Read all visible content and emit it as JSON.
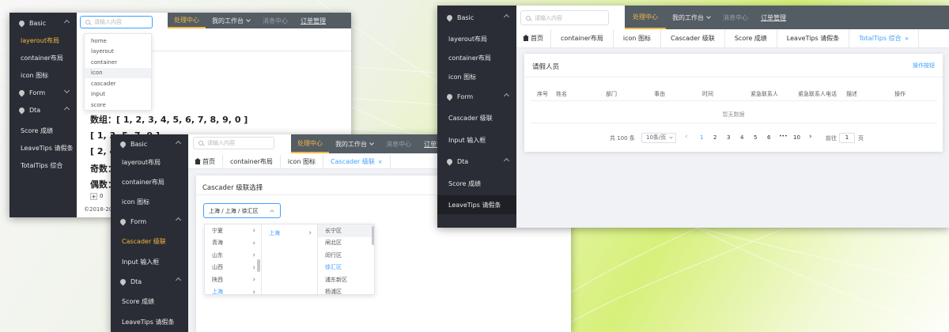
{
  "icons": {
    "group": "location-pin-icon",
    "collapse": "chevron-up-icon",
    "search": "search-icon",
    "home": "home-icon",
    "close": "close-icon",
    "expand": "chevron-right-icon"
  },
  "colors": {
    "accent": "#f2b843",
    "link": "#409eff",
    "sidebar": "#2a2d35",
    "topbar": "#545c64"
  },
  "w1": {
    "sidebar": {
      "basic": "Basic",
      "items": [
        "layerout布局",
        "container布局",
        "icon 图标"
      ],
      "form": "Form",
      "dta": "Dta",
      "dta_items": [
        "Score 成绩",
        "LeaveTips 请假条",
        "TotalTips 综合"
      ]
    },
    "search_placeholder": "请输入内容",
    "topnav": [
      "处理中心",
      "我的工作台",
      "消息中心",
      "订单管理"
    ],
    "suggestions": [
      "home",
      "layerout",
      "container",
      "icon",
      "cascader",
      "input",
      "score"
    ],
    "array_line": "数组：[ 1, 2, 3, 4, 5, 6, 7, 8, 9, 0 ]",
    "line2": "[ 1, 3, 5, 7, 9 ]",
    "line3": "[ 2, 4,",
    "odd": "奇数：",
    "even": "偶数：",
    "stepper_plus": "+",
    "stepper_value": "0",
    "copyright": "©2018-202"
  },
  "w2": {
    "sidebar": {
      "basic": "Basic",
      "items": [
        "layerout布局",
        "container布局",
        "icon 图标"
      ],
      "form": "Form",
      "form_items": [
        "Cascader 级联",
        "Input 输入框"
      ],
      "dta": "Dta",
      "dta_items": [
        "Score 成绩",
        "LeaveTips 请假条"
      ]
    },
    "search_placeholder": "请输入内容",
    "topnav": [
      "处理中心",
      "我的工作台",
      "消息中心",
      "订单管理"
    ],
    "tabs": [
      "首页",
      "container布局",
      "icon 图标",
      "Cascader 级联"
    ],
    "panel_title": "Cascader 级联选择",
    "cascader_value": "上海 / 上海 / 徐汇区",
    "col1": [
      "宁夏",
      "青海",
      "山东",
      "山西",
      "陕西",
      "上海"
    ],
    "col2": [
      "上海"
    ],
    "col3": [
      "长宁区",
      "闸北区",
      "闵行区",
      "徐汇区",
      "浦东新区",
      "杨浦区"
    ]
  },
  "w3": {
    "sidebar": {
      "basic": "Basic",
      "items": [
        "layerout布局",
        "container布局",
        "icon 图标"
      ],
      "form": "Form",
      "form_items": [
        "Cascader 级联",
        "Input 输入框"
      ],
      "dta": "Dta",
      "dta_items": [
        "Score 成绩",
        "LeaveTips 请假条"
      ]
    },
    "search_placeholder": "请输入内容",
    "topnav": [
      "处理中心",
      "我的工作台",
      "消息中心",
      "订单管理"
    ],
    "tabs": [
      "首页",
      "container布局",
      "icon 图标",
      "Cascader 级联",
      "Score 成绩",
      "LeaveTips 请假条",
      "TotalTips 综合"
    ],
    "card_title": "请假人员",
    "action_button": "操作按钮",
    "columns": [
      "序号",
      "姓名",
      "部门",
      "事由",
      "时间",
      "紧急联系人",
      "紧急联系人电话",
      "描述",
      "操作"
    ],
    "empty_text": "暂无数据",
    "pagination": {
      "total": "共 100 条",
      "page_size": "10条/页",
      "prev": "‹",
      "pages": [
        "1",
        "2",
        "3",
        "4",
        "5",
        "6",
        "10"
      ],
      "ellipsis": "•••",
      "next": "›",
      "goto": "前往",
      "goto_value": "1",
      "goto_suffix": "页"
    }
  }
}
